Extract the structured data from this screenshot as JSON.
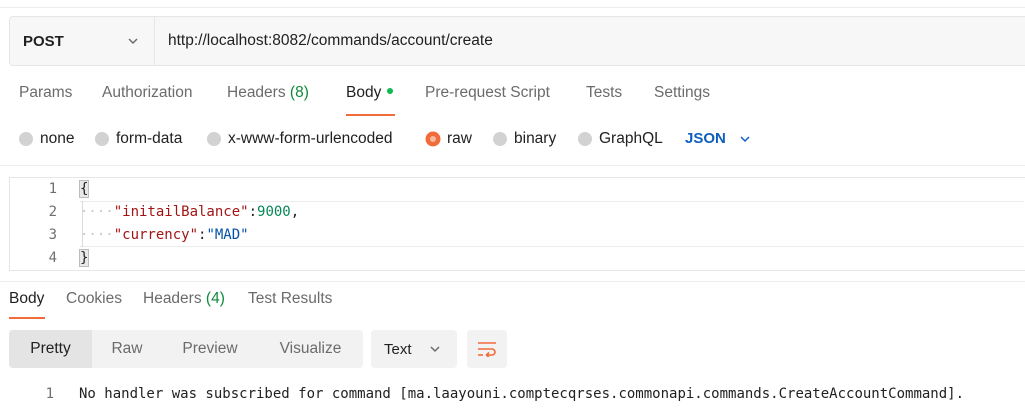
{
  "request": {
    "method": "POST",
    "url": "http://localhost:8082/commands/account/create"
  },
  "request_tabs": {
    "params": "Params",
    "authorization": "Authorization",
    "headers_label": "Headers",
    "headers_count": "(8)",
    "body": "Body",
    "pre_request": "Pre-request Script",
    "tests": "Tests",
    "settings": "Settings",
    "active": "Body"
  },
  "body_types": {
    "none": "none",
    "form_data": "form-data",
    "urlencoded": "x-www-form-urlencoded",
    "raw": "raw",
    "binary": "binary",
    "graphql": "GraphQL",
    "selected": "raw",
    "language": "JSON"
  },
  "editor": {
    "lines": [
      {
        "num": "1",
        "text": "{"
      },
      {
        "num": "2",
        "indent": "····",
        "key": "\"initailBalance\"",
        "sep": ":",
        "value": "9000",
        "trail": ","
      },
      {
        "num": "3",
        "indent": "····",
        "key": "\"currency\"",
        "sep": ":",
        "value": "\"MAD\""
      },
      {
        "num": "4",
        "text": "}"
      }
    ]
  },
  "response_tabs": {
    "body": "Body",
    "cookies": "Cookies",
    "headers_label": "Headers",
    "headers_count": "(4)",
    "test_results": "Test Results",
    "active": "Body"
  },
  "response_toolbar": {
    "pretty": "Pretty",
    "raw": "Raw",
    "preview": "Preview",
    "visualize": "Visualize",
    "format": "Text"
  },
  "response_body": {
    "line_num": "1",
    "text": "No handler was subscribed for command [ma.laayouni.comptecqrses.commonapi.commands.CreateAccountCommand]."
  },
  "colors": {
    "accent": "#f26b3a",
    "active_dot": "#0cbb52",
    "count_green": "#0f8a3c",
    "json_blue": "#0f5fbd"
  }
}
